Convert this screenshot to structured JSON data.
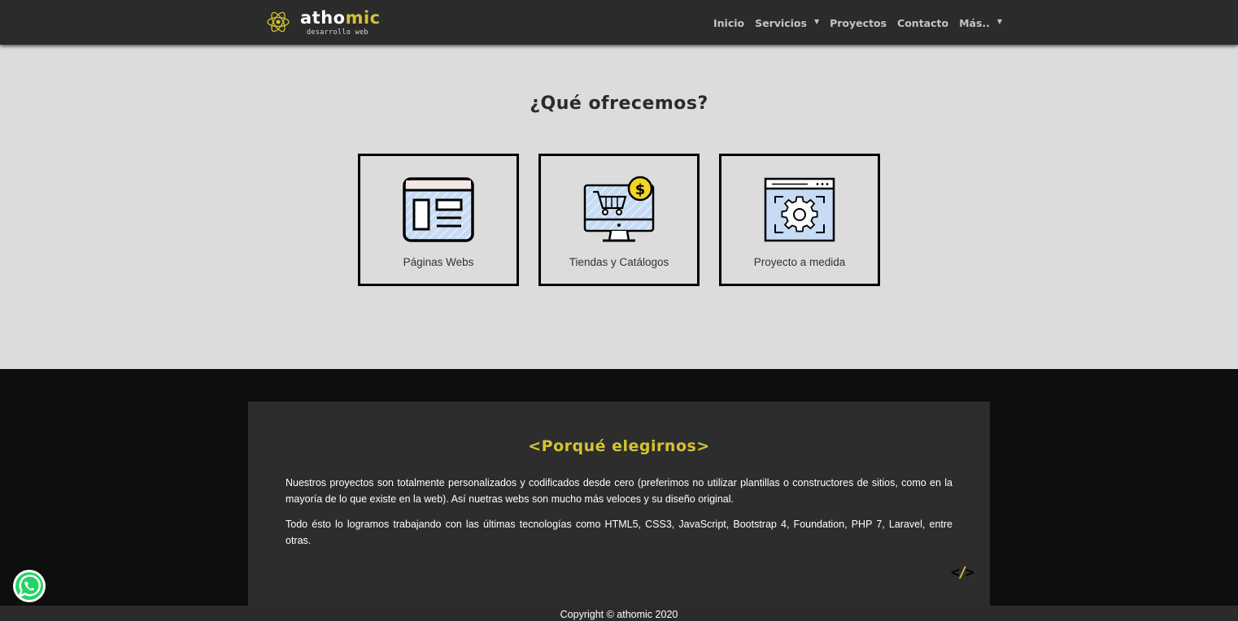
{
  "brand": {
    "name_main": "atho",
    "name_accent": "mic",
    "tagline": "desarrollo web",
    "logo_icon": "atom-icon"
  },
  "nav": {
    "items": [
      {
        "label": "Inicio",
        "dropdown": false
      },
      {
        "label": "Servicios",
        "dropdown": true
      },
      {
        "label": "Proyectos",
        "dropdown": false
      },
      {
        "label": "Contacto",
        "dropdown": false
      },
      {
        "label": "Más..",
        "dropdown": true
      }
    ],
    "caret": "▼"
  },
  "services": {
    "title": "¿Qué ofrecemos?",
    "cards": [
      {
        "label": "Páginas Webs",
        "icon": "web-layout-icon"
      },
      {
        "label": "Tiendas y Catálogos",
        "icon": "online-store-icon"
      },
      {
        "label": "Proyecto a medida",
        "icon": "custom-project-gear-icon"
      }
    ]
  },
  "why": {
    "title": "<Porqué elegirnos>",
    "paragraph1": "Nuestros proyectos son totalmente personalizados y codificados desde cero (preferimos no utilizar plantillas o constructores de sitios, como en la mayoría de lo que existe en la web). Así nuetras webs son mucho más veloces y su diseño original.",
    "paragraph2": "Todo ésto lo logramos trabajando con las últimas tecnologías como HTML5, CSS3, JavaScript, Bootstrap 4, Foundation, PHP 7, Laravel, entre otras.",
    "code_open": "<",
    "code_slash": "/",
    "code_close": ">"
  },
  "footer": {
    "copyright": "Copyright © athomic 2020"
  },
  "colors": {
    "accent": "#d4c234",
    "navbar": "#2b2b2b",
    "section_light": "#dcdcdc",
    "section_dark": "#0e0e0e",
    "panel": "#2d2d2d",
    "whatsapp": "#25d366"
  },
  "floating": {
    "whatsapp_icon": "whatsapp-icon"
  }
}
